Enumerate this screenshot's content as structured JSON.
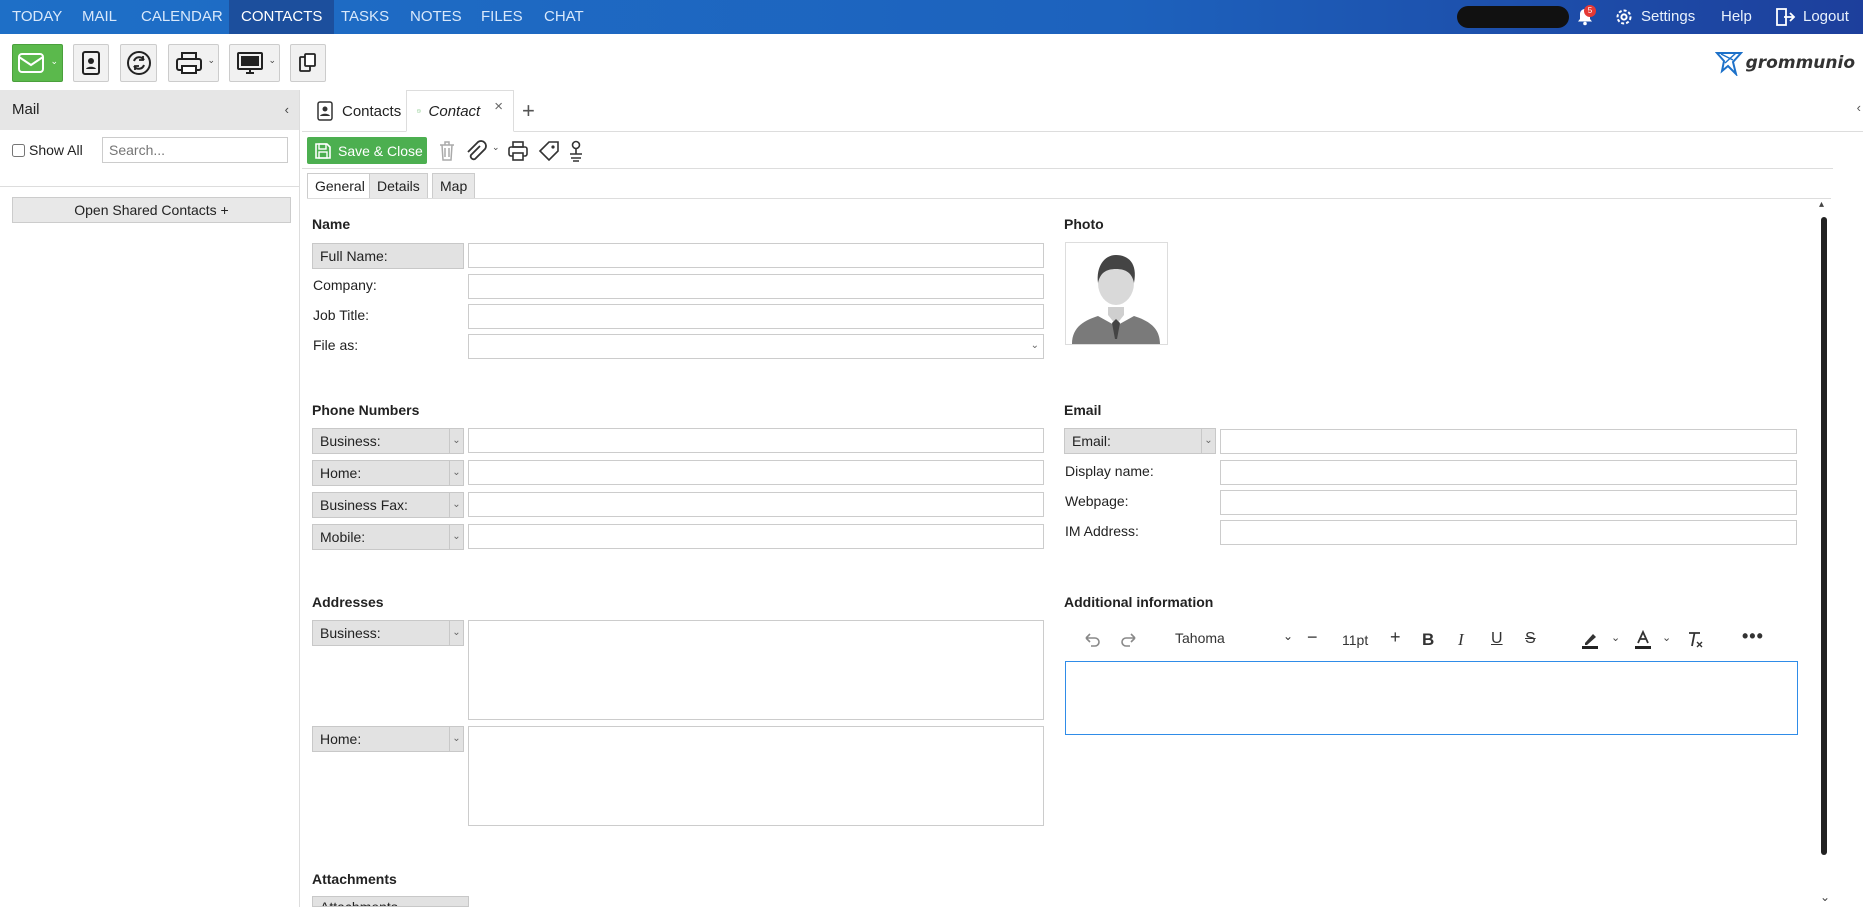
{
  "topnav": {
    "items": [
      "TODAY",
      "MAIL",
      "CALENDAR",
      "CONTACTS",
      "TASKS",
      "NOTES",
      "FILES",
      "CHAT"
    ],
    "active": "CONTACTS",
    "notification_count": "5",
    "settings_label": "Settings",
    "help_label": "Help",
    "logout_label": "Logout"
  },
  "brand": {
    "logo_text": "grommunio"
  },
  "leftpane": {
    "header": "Mail",
    "show_all_label": "Show All",
    "search_placeholder": "Search...",
    "shared_button": "Open Shared Contacts +"
  },
  "tabs": {
    "contacts_label": "Contacts",
    "contact_label": "Contact",
    "add_label": "+"
  },
  "actionbar": {
    "save_close_label": "Save & Close"
  },
  "subtabs": [
    "General",
    "Details",
    "Map"
  ],
  "form": {
    "name_section": "Name",
    "full_name_label": "Full Name:",
    "company_label": "Company:",
    "job_title_label": "Job Title:",
    "file_as_label": "File as:",
    "photo_section": "Photo",
    "phone_section": "Phone Numbers",
    "phone_labels": [
      "Business:",
      "Home:",
      "Business Fax:",
      "Mobile:"
    ],
    "email_section": "Email",
    "email_label": "Email:",
    "display_name_label": "Display name:",
    "webpage_label": "Webpage:",
    "im_label": "IM Address:",
    "addresses_section": "Addresses",
    "address_labels": [
      "Business:",
      "Home:"
    ],
    "additional_section": "Additional information",
    "attachments_section": "Attachments",
    "attachments_button": "Attachments..."
  },
  "editor": {
    "font": "Tahoma",
    "size": "11pt"
  },
  "colors": {
    "nav_blue": "#1e6fc7",
    "save_green": "#4caf50",
    "mail_green": "#5bb94c"
  }
}
